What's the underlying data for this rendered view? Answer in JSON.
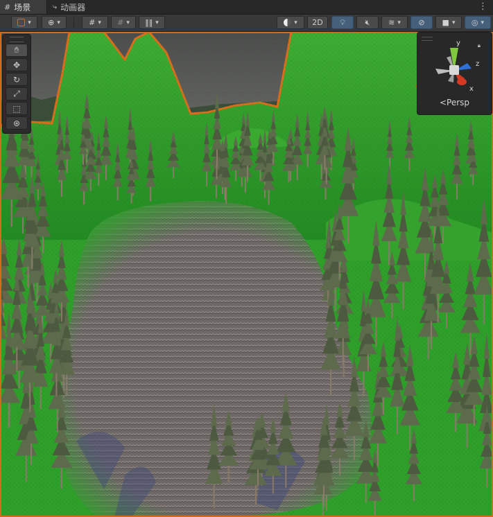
{
  "tabs": [
    {
      "icon": "grid-icon",
      "label": "场景"
    },
    {
      "icon": "animator-icon",
      "label": "动画器"
    }
  ],
  "toolbar": {
    "twod_label": "2D"
  },
  "gizmo": {
    "axes": {
      "y": "y",
      "z": "z",
      "x": "x"
    },
    "projection_label": "Persp"
  },
  "colors": {
    "selection_outline": "#d46a1d",
    "terrain_green": "#2fa02a",
    "path_gray": "#6f6a69",
    "gizmo_x": "#d23a24",
    "gizmo_y": "#7fc93e",
    "gizmo_z": "#2e6fd8"
  }
}
